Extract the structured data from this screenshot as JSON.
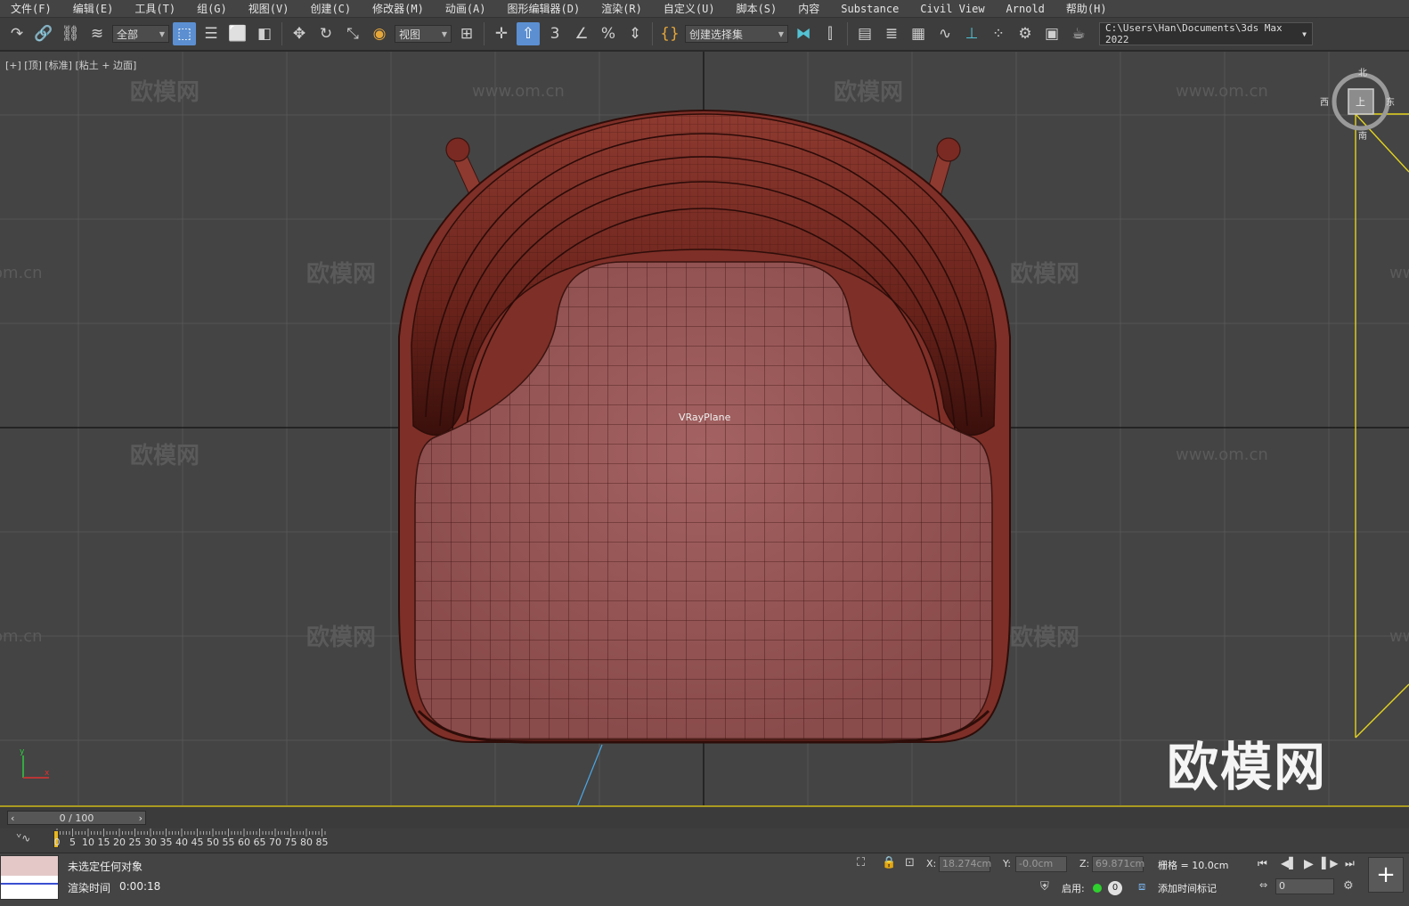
{
  "menu": [
    "文件(F)",
    "编辑(E)",
    "工具(T)",
    "组(G)",
    "视图(V)",
    "创建(C)",
    "修改器(M)",
    "动画(A)",
    "图形编辑器(D)",
    "渲染(R)",
    "自定义(U)",
    "脚本(S)",
    "内容",
    "Substance",
    "Civil View",
    "Arnold",
    "帮助(H)"
  ],
  "toolbar": {
    "filter_dropdown": "全部",
    "refcoord_dropdown": "视图",
    "selection_set_dropdown": "创建选择集",
    "snap_toggle_label": "3",
    "project_path": "C:\\Users\\Han\\Documents\\3ds Max 2022"
  },
  "viewport": {
    "label": "[+] [顶] [标准] [粘土 + 边面]",
    "object_label": "VRayPlane",
    "watermark_small": [
      "欧模网",
      "www.om.cn"
    ],
    "watermark_big": "欧模网",
    "viewcube": {
      "north": "北",
      "south": "南",
      "east": "东",
      "west": "西",
      "face": "上"
    }
  },
  "timeline": {
    "frame_display": "0 / 100",
    "ticks": [
      "0",
      "5",
      "10",
      "15",
      "20",
      "25",
      "30",
      "35",
      "40",
      "45",
      "50",
      "55",
      "60",
      "65",
      "70",
      "75",
      "80",
      "85"
    ]
  },
  "status": {
    "selection": "未选定任何对象",
    "render_time_label": "渲染时间",
    "render_time": "0:00:18",
    "x_label": "X:",
    "x_value": "18.274cm",
    "y_label": "Y:",
    "y_value": "-0.0cm",
    "z_label": "Z:",
    "z_value": "69.871cm",
    "grid": "栅格 = 10.0cm",
    "enable_label": "启用:",
    "enable_count": "0",
    "add_time_tag": "添加时间标记",
    "frame_field": "0"
  },
  "colors": {
    "chair_fill": "#9d5c5c",
    "chair_dark": "#5c1e16",
    "selection_box": "#e4d41c",
    "grid_line": "#555555"
  }
}
